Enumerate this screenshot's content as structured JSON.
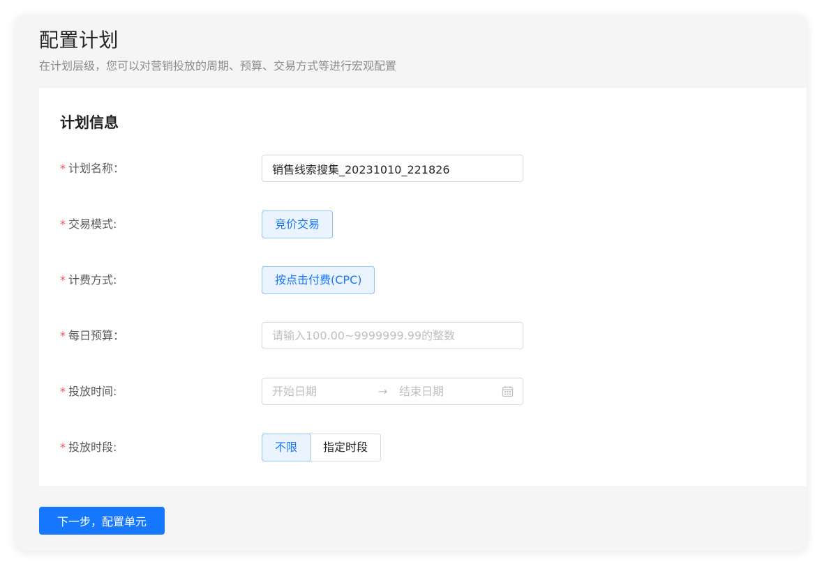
{
  "header": {
    "title": "配置计划",
    "subtitle": "在计划层级，您可以对营销投放的周期、预算、交易方式等进行宏观配置"
  },
  "section": {
    "title": "计划信息"
  },
  "form": {
    "required_mark": "*",
    "plan_name": {
      "label": "计划名称：",
      "value": "销售线索搜集_20231010_221826"
    },
    "trade_mode": {
      "label": "交易模式:",
      "option": "竞价交易"
    },
    "billing": {
      "label": "计费方式:",
      "option": "按点击付费(CPC)"
    },
    "daily_budget": {
      "label": "每日预算：",
      "placeholder": "请输入100.00~9999999.99的整数"
    },
    "schedule": {
      "label": "投放时间:",
      "start_placeholder": "开始日期",
      "arrow": "→",
      "end_placeholder": "结束日期"
    },
    "time_slot": {
      "label": "投放时段:",
      "options": [
        "不限",
        "指定时段"
      ],
      "selected": "不限"
    }
  },
  "actions": {
    "next_label": "下一步，配置单元"
  },
  "colors": {
    "primary": "#1677ff",
    "required": "#ff4d4f",
    "tag_bg": "#eaf3ff",
    "tag_border": "#91c3fd"
  }
}
